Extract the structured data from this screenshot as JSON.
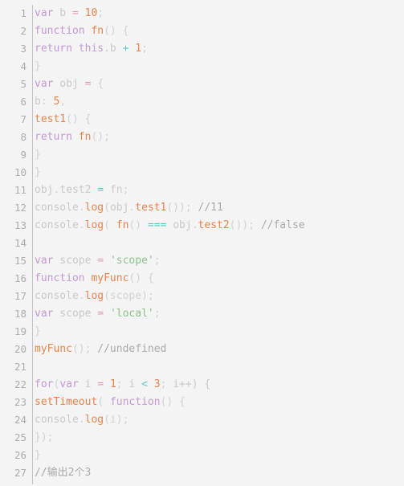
{
  "editor": {
    "background_color": "#f4f4f4",
    "gutter_divider_color": "#c3c3c3",
    "line_number_color": "#adadad",
    "total_lines": 27,
    "language": "javascript"
  },
  "palette": {
    "keyword": "#c39ad4",
    "function_name": "#e8834a",
    "number": "#e8834a",
    "string": "#8cc28c",
    "operator": "#5fc9bd",
    "assignment": "#e59bb0",
    "plain": "#c9c9c9",
    "punctuation": "#d2d2d2",
    "comment": "#aaaaaa"
  },
  "lines": [
    {
      "n": "1",
      "text": "var b = 10;"
    },
    {
      "n": "2",
      "text": "function fn() {"
    },
    {
      "n": "3",
      "text": "return this.b + 1;"
    },
    {
      "n": "4",
      "text": "}"
    },
    {
      "n": "5",
      "text": "var obj = {"
    },
    {
      "n": "6",
      "text": "b: 5,"
    },
    {
      "n": "7",
      "text": "test1() {"
    },
    {
      "n": "8",
      "text": "return fn();"
    },
    {
      "n": "9",
      "text": "}"
    },
    {
      "n": "10",
      "text": "}"
    },
    {
      "n": "11",
      "text": "obj.test2 = fn;"
    },
    {
      "n": "12",
      "text": "console.log(obj.test1()); //11"
    },
    {
      "n": "13",
      "text": "console.log( fn() === obj.test2()); //false"
    },
    {
      "n": "14",
      "text": ""
    },
    {
      "n": "15",
      "text": "var scope = 'scope';"
    },
    {
      "n": "16",
      "text": "function myFunc() {"
    },
    {
      "n": "17",
      "text": "console.log(scope);"
    },
    {
      "n": "18",
      "text": "var scope = 'local';"
    },
    {
      "n": "19",
      "text": "}"
    },
    {
      "n": "20",
      "text": "myFunc(); //undefined"
    },
    {
      "n": "21",
      "text": ""
    },
    {
      "n": "22",
      "text": "for(var i = 1; i < 3; i++) {"
    },
    {
      "n": "23",
      "text": "setTimeout( function() {"
    },
    {
      "n": "24",
      "text": "console.log(i);"
    },
    {
      "n": "25",
      "text": "});"
    },
    {
      "n": "26",
      "text": "}"
    },
    {
      "n": "27",
      "text": "//输出2个3"
    }
  ],
  "tokens": [
    [
      {
        "t": "var",
        "c": "t-kw"
      },
      {
        "t": " b ",
        "c": "t-plain"
      },
      {
        "t": "=",
        "c": "t-eq"
      },
      {
        "t": " ",
        "c": "t-plain"
      },
      {
        "t": "10",
        "c": "t-num"
      },
      {
        "t": ";",
        "c": "t-punct"
      }
    ],
    [
      {
        "t": "function",
        "c": "t-kw"
      },
      {
        "t": " ",
        "c": "t-plain"
      },
      {
        "t": "fn",
        "c": "t-fn"
      },
      {
        "t": "() {",
        "c": "t-punct"
      }
    ],
    [
      {
        "t": "return",
        "c": "t-kw"
      },
      {
        "t": " ",
        "c": "t-plain"
      },
      {
        "t": "this",
        "c": "t-kw"
      },
      {
        "t": ".b ",
        "c": "t-plain"
      },
      {
        "t": "+",
        "c": "t-op"
      },
      {
        "t": " ",
        "c": "t-plain"
      },
      {
        "t": "1",
        "c": "t-num"
      },
      {
        "t": ";",
        "c": "t-punct"
      }
    ],
    [
      {
        "t": "}",
        "c": "t-punct"
      }
    ],
    [
      {
        "t": "var",
        "c": "t-kw"
      },
      {
        "t": " obj ",
        "c": "t-plain"
      },
      {
        "t": "=",
        "c": "t-eq"
      },
      {
        "t": " {",
        "c": "t-punct"
      }
    ],
    [
      {
        "t": "b",
        "c": "t-plain"
      },
      {
        "t": ": ",
        "c": "t-punct"
      },
      {
        "t": "5",
        "c": "t-num"
      },
      {
        "t": ",",
        "c": "t-punct"
      }
    ],
    [
      {
        "t": "test1",
        "c": "t-fn"
      },
      {
        "t": "() {",
        "c": "t-punct"
      }
    ],
    [
      {
        "t": "return",
        "c": "t-kw"
      },
      {
        "t": " ",
        "c": "t-plain"
      },
      {
        "t": "fn",
        "c": "t-fn"
      },
      {
        "t": "();",
        "c": "t-punct"
      }
    ],
    [
      {
        "t": "}",
        "c": "t-punct"
      }
    ],
    [
      {
        "t": "}",
        "c": "t-punct"
      }
    ],
    [
      {
        "t": "obj",
        "c": "t-plain"
      },
      {
        "t": ".",
        "c": "t-punct"
      },
      {
        "t": "test2",
        "c": "t-plain"
      },
      {
        "t": " ",
        "c": "t-plain"
      },
      {
        "t": "=",
        "c": "t-op"
      },
      {
        "t": " fn",
        "c": "t-plain"
      },
      {
        "t": ";",
        "c": "t-punct"
      }
    ],
    [
      {
        "t": "console",
        "c": "t-plain"
      },
      {
        "t": ".",
        "c": "t-punct"
      },
      {
        "t": "log",
        "c": "t-fn"
      },
      {
        "t": "(",
        "c": "t-punct"
      },
      {
        "t": "obj",
        "c": "t-plain"
      },
      {
        "t": ".",
        "c": "t-punct"
      },
      {
        "t": "test1",
        "c": "t-fn"
      },
      {
        "t": "()); ",
        "c": "t-punct"
      },
      {
        "t": "//11",
        "c": "t-comment"
      }
    ],
    [
      {
        "t": "console",
        "c": "t-plain"
      },
      {
        "t": ".",
        "c": "t-punct"
      },
      {
        "t": "log",
        "c": "t-fn"
      },
      {
        "t": "( ",
        "c": "t-punct"
      },
      {
        "t": "fn",
        "c": "t-fn"
      },
      {
        "t": "() ",
        "c": "t-punct"
      },
      {
        "t": "===",
        "c": "t-op"
      },
      {
        "t": " obj",
        "c": "t-plain"
      },
      {
        "t": ".",
        "c": "t-punct"
      },
      {
        "t": "test2",
        "c": "t-fn"
      },
      {
        "t": "()); ",
        "c": "t-punct"
      },
      {
        "t": "//false",
        "c": "t-comment"
      }
    ],
    [],
    [
      {
        "t": "var",
        "c": "t-kw"
      },
      {
        "t": " scope ",
        "c": "t-plain"
      },
      {
        "t": "=",
        "c": "t-eq"
      },
      {
        "t": " ",
        "c": "t-plain"
      },
      {
        "t": "'scope'",
        "c": "t-str"
      },
      {
        "t": ";",
        "c": "t-punct"
      }
    ],
    [
      {
        "t": "function",
        "c": "t-kw"
      },
      {
        "t": " ",
        "c": "t-plain"
      },
      {
        "t": "myFunc",
        "c": "t-fn"
      },
      {
        "t": "() {",
        "c": "t-punct"
      }
    ],
    [
      {
        "t": "console",
        "c": "t-plain"
      },
      {
        "t": ".",
        "c": "t-punct"
      },
      {
        "t": "log",
        "c": "t-fn"
      },
      {
        "t": "(scope);",
        "c": "t-punct"
      }
    ],
    [
      {
        "t": "var",
        "c": "t-kw"
      },
      {
        "t": " scope ",
        "c": "t-plain"
      },
      {
        "t": "=",
        "c": "t-eq"
      },
      {
        "t": " ",
        "c": "t-plain"
      },
      {
        "t": "'local'",
        "c": "t-str"
      },
      {
        "t": ";",
        "c": "t-punct"
      }
    ],
    [
      {
        "t": "}",
        "c": "t-punct"
      }
    ],
    [
      {
        "t": "myFunc",
        "c": "t-fn"
      },
      {
        "t": "(); ",
        "c": "t-punct"
      },
      {
        "t": "//undefined",
        "c": "t-comment"
      }
    ],
    [],
    [
      {
        "t": "for",
        "c": "t-kw"
      },
      {
        "t": "(",
        "c": "t-punct"
      },
      {
        "t": "var",
        "c": "t-kw"
      },
      {
        "t": " i ",
        "c": "t-plain"
      },
      {
        "t": "=",
        "c": "t-eq"
      },
      {
        "t": " ",
        "c": "t-plain"
      },
      {
        "t": "1",
        "c": "t-num"
      },
      {
        "t": "; ",
        "c": "t-punct"
      },
      {
        "t": "i ",
        "c": "t-plain"
      },
      {
        "t": "<",
        "c": "t-op"
      },
      {
        "t": " ",
        "c": "t-plain"
      },
      {
        "t": "3",
        "c": "t-num"
      },
      {
        "t": "; ",
        "c": "t-punct"
      },
      {
        "t": "i++) {",
        "c": "t-plain"
      }
    ],
    [
      {
        "t": "setTimeout",
        "c": "t-fn"
      },
      {
        "t": "( ",
        "c": "t-punct"
      },
      {
        "t": "function",
        "c": "t-kw"
      },
      {
        "t": "() {",
        "c": "t-punct"
      }
    ],
    [
      {
        "t": "console",
        "c": "t-plain"
      },
      {
        "t": ".",
        "c": "t-punct"
      },
      {
        "t": "log",
        "c": "t-fn"
      },
      {
        "t": "(i);",
        "c": "t-punct"
      }
    ],
    [
      {
        "t": "});",
        "c": "t-punct"
      }
    ],
    [
      {
        "t": "}",
        "c": "t-punct"
      }
    ],
    [
      {
        "t": "//输出2个3",
        "c": "t-comment"
      }
    ]
  ]
}
